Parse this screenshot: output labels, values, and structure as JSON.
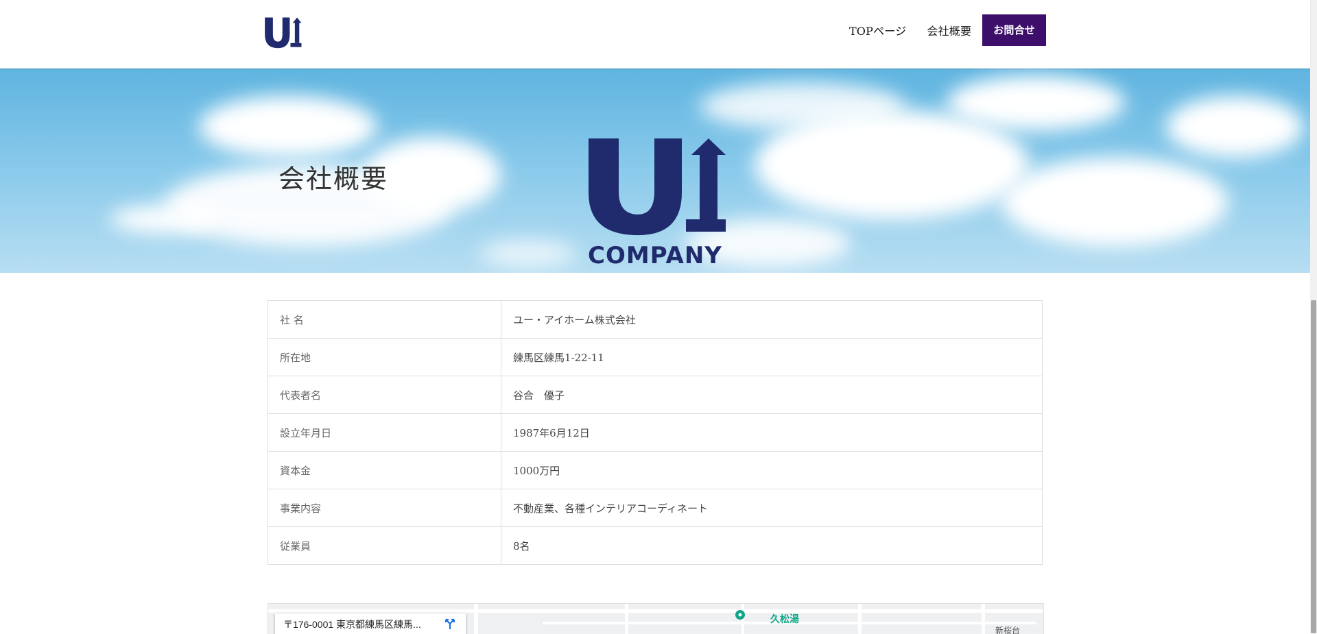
{
  "header": {
    "logo_alt": "UI COMPANY",
    "nav": [
      {
        "label": "TOPページ"
      },
      {
        "label": "会社概要"
      },
      {
        "label": "お問合せ"
      }
    ]
  },
  "hero": {
    "title": "会社概要",
    "logo_text": "COMPANY"
  },
  "company_table": {
    "rows": [
      {
        "label": "社 名",
        "value": "ユー・アイホーム株式会社"
      },
      {
        "label": "所在地",
        "value": "練馬区練馬1-22-11"
      },
      {
        "label": "代表者名",
        "value": "谷合　優子"
      },
      {
        "label": "設立年月日",
        "value": "1987年6月12日"
      },
      {
        "label": "資本金",
        "value": "1000万円"
      },
      {
        "label": "事業内容",
        "value": "不動産業、各種インテリアコーディネート"
      },
      {
        "label": "従業員",
        "value": "8名"
      }
    ]
  },
  "map": {
    "address": "〒176-0001 東京都練馬区練馬...",
    "poi_kyushoyu": "久松湯",
    "poi_shinsakuradai": "新桜台"
  },
  "colors": {
    "accent": "#3d0f6b",
    "logo_navy": "#1f2b6c"
  },
  "icons": {
    "directions": "directions-icon",
    "poi": "map-pin-icon"
  }
}
